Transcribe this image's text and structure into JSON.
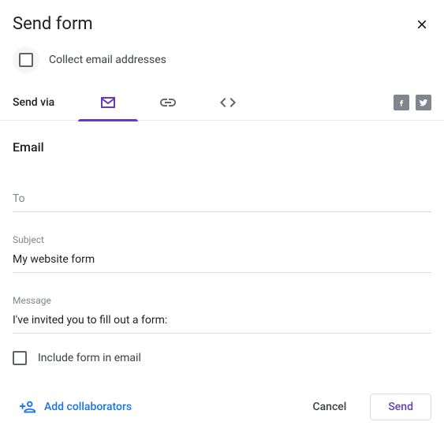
{
  "header": {
    "title": "Send form"
  },
  "collect": {
    "label": "Collect email addresses",
    "checked": false
  },
  "sendvia": {
    "label": "Send via",
    "active_tab": "email"
  },
  "share": {
    "facebook": "facebook",
    "twitter": "twitter"
  },
  "email": {
    "section_title": "Email",
    "to_label": "To",
    "to_value": "",
    "subject_label": "Subject",
    "subject_value": "My website form",
    "message_label": "Message",
    "message_value": "I've invited you to fill out a form:"
  },
  "include": {
    "label": "Include form in email",
    "checked": false
  },
  "footer": {
    "add_collaborators": "Add collaborators",
    "cancel": "Cancel",
    "send": "Send"
  }
}
